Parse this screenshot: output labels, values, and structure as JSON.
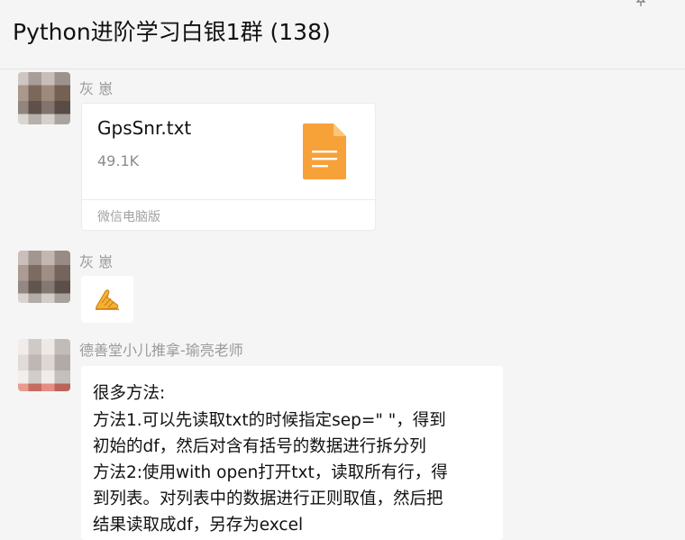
{
  "header": {
    "title": "Python进阶学习白银1群 (138)",
    "pin_icon": "pin-icon",
    "more_icon": "more-icon"
  },
  "messages": [
    {
      "sender": "灰 崽",
      "type": "file",
      "file": {
        "name": "GpsSnr.txt",
        "size": "49.1K",
        "source": "微信电脑版",
        "icon": "document-icon",
        "icon_color": "#f7a139"
      }
    },
    {
      "sender": "灰 崽",
      "type": "sticker",
      "sticker_icon": "praying-hands-icon"
    },
    {
      "sender": "德善堂小儿推拿-瑜亮老师",
      "type": "text",
      "lines": [
        "很多方法:",
        "方法1.可以先读取txt的时候指定sep=\" \"，得到",
        "初始的df，然后对含有括号的数据进行拆分列",
        "方法2:使用with open打开txt，读取所有行，得",
        "到列表。对列表中的数据进行正则取值，然后把",
        "结果读取成df，另存为excel"
      ]
    }
  ],
  "colors": {
    "background": "#f5f5f5",
    "bubble": "#ffffff",
    "sender_text": "#9a9a9a"
  }
}
